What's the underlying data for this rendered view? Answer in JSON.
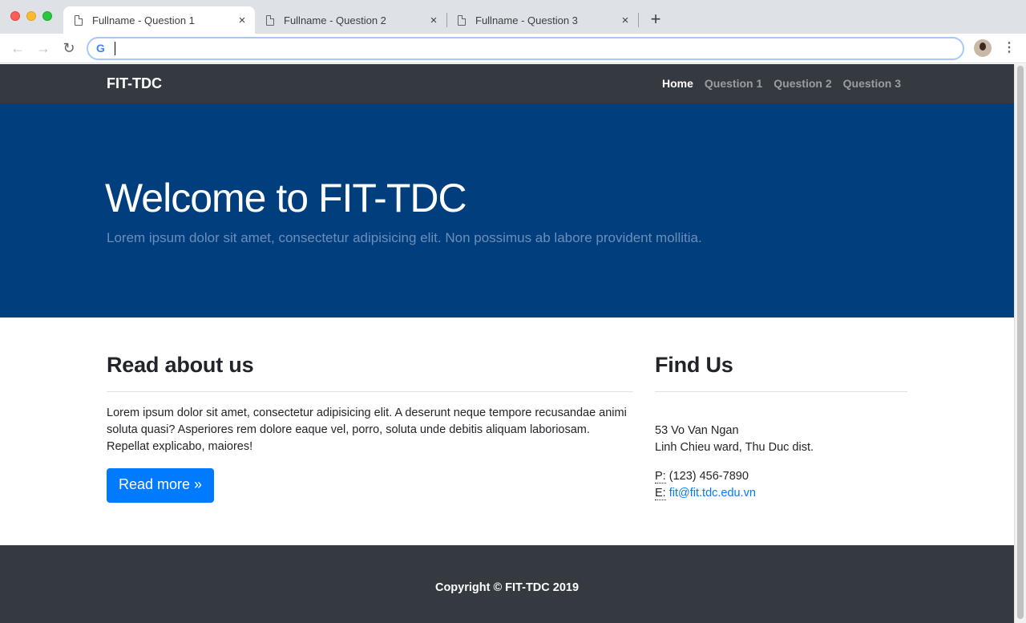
{
  "browser": {
    "tabs": [
      {
        "label": "Fullname - Question 1",
        "active": true
      },
      {
        "label": "Fullname - Question 2",
        "active": false
      },
      {
        "label": "Fullname - Question 3",
        "active": false
      }
    ],
    "tab_close_glyph": "×",
    "new_tab_glyph": "+",
    "address_value": "",
    "nav": {
      "back": "←",
      "forward": "→",
      "reload": "↻",
      "menu": "⋮"
    },
    "icons": {
      "tab": "document-icon",
      "omnibox": "google-icon",
      "profile": "avatar"
    }
  },
  "navbar": {
    "brand": "FIT-TDC",
    "links": [
      "Home",
      "Question 1",
      "Question 2",
      "Question 3"
    ],
    "active_link": "Home"
  },
  "hero": {
    "title": "Welcome to FIT-TDC",
    "subtitle": "Lorem ipsum dolor sit amet, consectetur adipisicing elit. Non possimus ab labore provident mollitia."
  },
  "about": {
    "heading": "Read about us",
    "text": "Lorem ipsum dolor sit amet, consectetur adipisicing elit. A deserunt neque tempore recusandae animi soluta quasi? Asperiores rem dolore eaque vel, porro, soluta unde debitis aliquam laboriosam. Repellat explicabo, maiores!",
    "button": "Read more »"
  },
  "find": {
    "heading": "Find Us",
    "address_line1": "53 Vo Van Ngan",
    "address_line2": "Linh Chieu ward, Thu Duc dist.",
    "phone_label": "P:",
    "phone": "(123) 456-7890",
    "email_label": "E:",
    "email": "fit@fit.tdc.edu.vn"
  },
  "footer": {
    "copyright": "Copyright © FIT-TDC 2019"
  },
  "colors": {
    "navbar": "#343a40",
    "hero": "#003e7e",
    "primary": "#007bff"
  }
}
